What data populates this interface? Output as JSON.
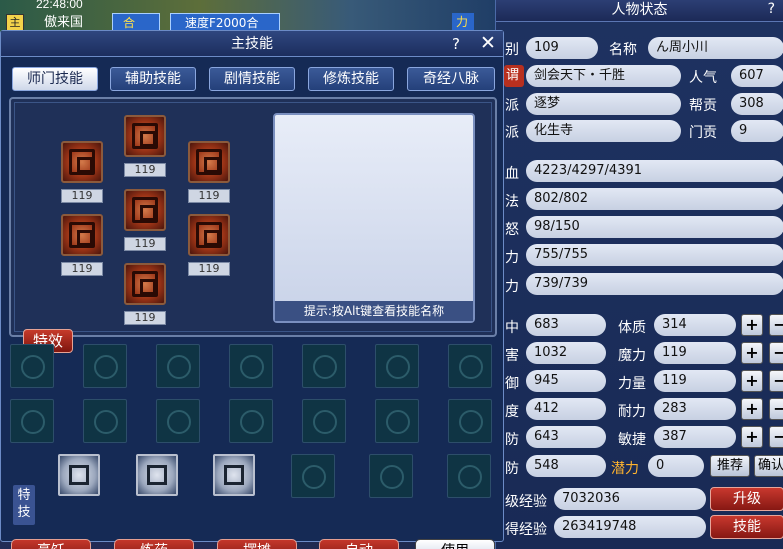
{
  "topbar": {
    "time": "22:48:00",
    "place": "傲来国",
    "zhu": "主",
    "tag1": "合",
    "tag2": "速度F2000合",
    "tag3": "力"
  },
  "status": {
    "title": "人物状态",
    "help": "?",
    "rows": [
      {
        "label": "别",
        "value": "109"
      },
      {
        "label": "名称",
        "value": "ん周小川"
      },
      {
        "label": "谓",
        "value": "剑会天下・千胜"
      },
      {
        "label": "人气",
        "value": "607"
      },
      {
        "label": "派",
        "value": "逐梦"
      },
      {
        "label": "帮贡",
        "value": "308"
      },
      {
        "label": "派",
        "value": "化生寺"
      },
      {
        "label": "门贡",
        "value": "9"
      }
    ],
    "hp": [
      {
        "label": "血",
        "value": "4223/4297/4391"
      },
      {
        "label": "法",
        "value": "802/802"
      },
      {
        "label": "怒",
        "value": "98/150"
      },
      {
        "label": "力",
        "value": "755/755"
      },
      {
        "label": "力",
        "value": "739/739"
      }
    ],
    "attrs": [
      {
        "l": "中",
        "v": "683",
        "l2": "体质",
        "v2": "314"
      },
      {
        "l": "害",
        "v": "1032",
        "l2": "魔力",
        "v2": "119"
      },
      {
        "l": "御",
        "v": "945",
        "l2": "力量",
        "v2": "119"
      },
      {
        "l": "度",
        "v": "412",
        "l2": "耐力",
        "v2": "283"
      },
      {
        "l": "防",
        "v": "643",
        "l2": "敏捷",
        "v2": "387"
      }
    ],
    "last": {
      "l": "防",
      "v": "548",
      "potential_label": "潜力",
      "potential": "0",
      "recommend": "推荐",
      "confirm": "确认"
    },
    "exp_label": "级经验",
    "exp": "7032036",
    "upgrade": "升级",
    "gain_label": "得经验",
    "gain": "263419748",
    "skill": "技能",
    "plus": "+",
    "minus": "−"
  },
  "skills": {
    "title": "主技能",
    "help": "?",
    "close": "✕",
    "tabs": [
      "师门技能",
      "辅助技能",
      "剧情技能",
      "修炼技能",
      "奇经八脉"
    ],
    "levels": [
      "119",
      "119",
      "119",
      "119",
      "119",
      "119",
      "119"
    ],
    "hint": "提示:按Alt键查看技能名称",
    "effect": "特效",
    "special_label": "特技",
    "buttons": [
      "烹饪",
      "炼药",
      "摆摊",
      "自动",
      "使用"
    ]
  }
}
